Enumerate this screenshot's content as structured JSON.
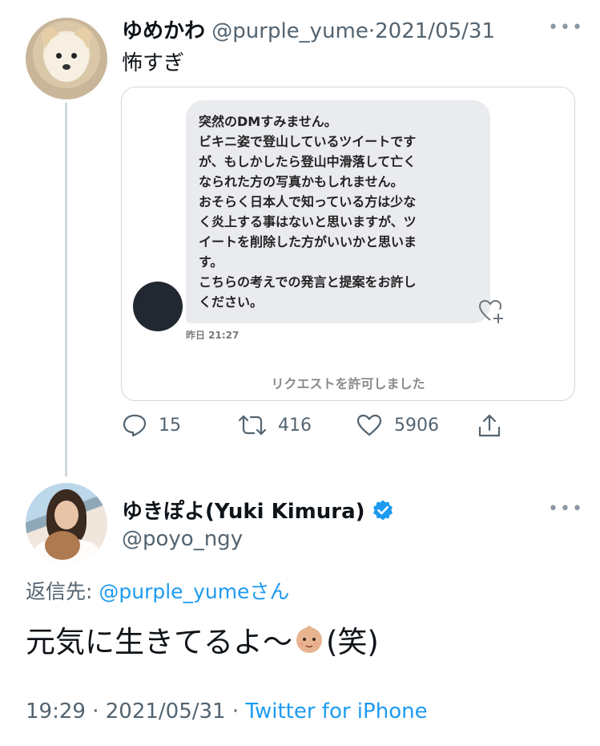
{
  "tweet1": {
    "display_name": "ゆめかわ",
    "handle": "@purple_yume",
    "separator": "·",
    "date": "2021/05/31",
    "more_label": "•••",
    "text": "怖すぎ",
    "dm_card": {
      "message_lines": [
        "突然のDMすみません。",
        "ビキニ姿で登山しているツイートです",
        "が、もしかしたら登山中滑落して亡く",
        "なられた方の写真かもしれません。",
        "おそらく日本人で知っている方は少な",
        "く炎上する事はないと思いますが、ツ",
        "イートを削除した方がいいかと思いま",
        "す。",
        "こちらの考えでの発言と提案をお許し",
        "ください。"
      ],
      "timestamp": "昨日 21:27",
      "request_status": "リクエストを許可しました"
    },
    "actions": {
      "reply_count": "15",
      "retweet_count": "416",
      "like_count": "5906"
    }
  },
  "tweet2": {
    "display_name": "ゆきぽよ(Yuki Kimura)",
    "verified": true,
    "handle": "@poyo_ngy",
    "more_label": "•••",
    "reply_prefix": "返信先: ",
    "reply_target": "@purple_yumeさん",
    "text_before_emoji": "元気に生きてるよ〜",
    "emoji": "baby-face",
    "text_after_emoji": "(笑)",
    "meta": {
      "time": "19:29",
      "separator1": " · ",
      "date": "2021/05/31",
      "separator2": " · ",
      "source": "Twitter for iPhone"
    }
  },
  "colors": {
    "link": "#1d9bf0",
    "muted": "#536471",
    "verified": "#1d9bf0",
    "bubble": "#e9ebef"
  }
}
